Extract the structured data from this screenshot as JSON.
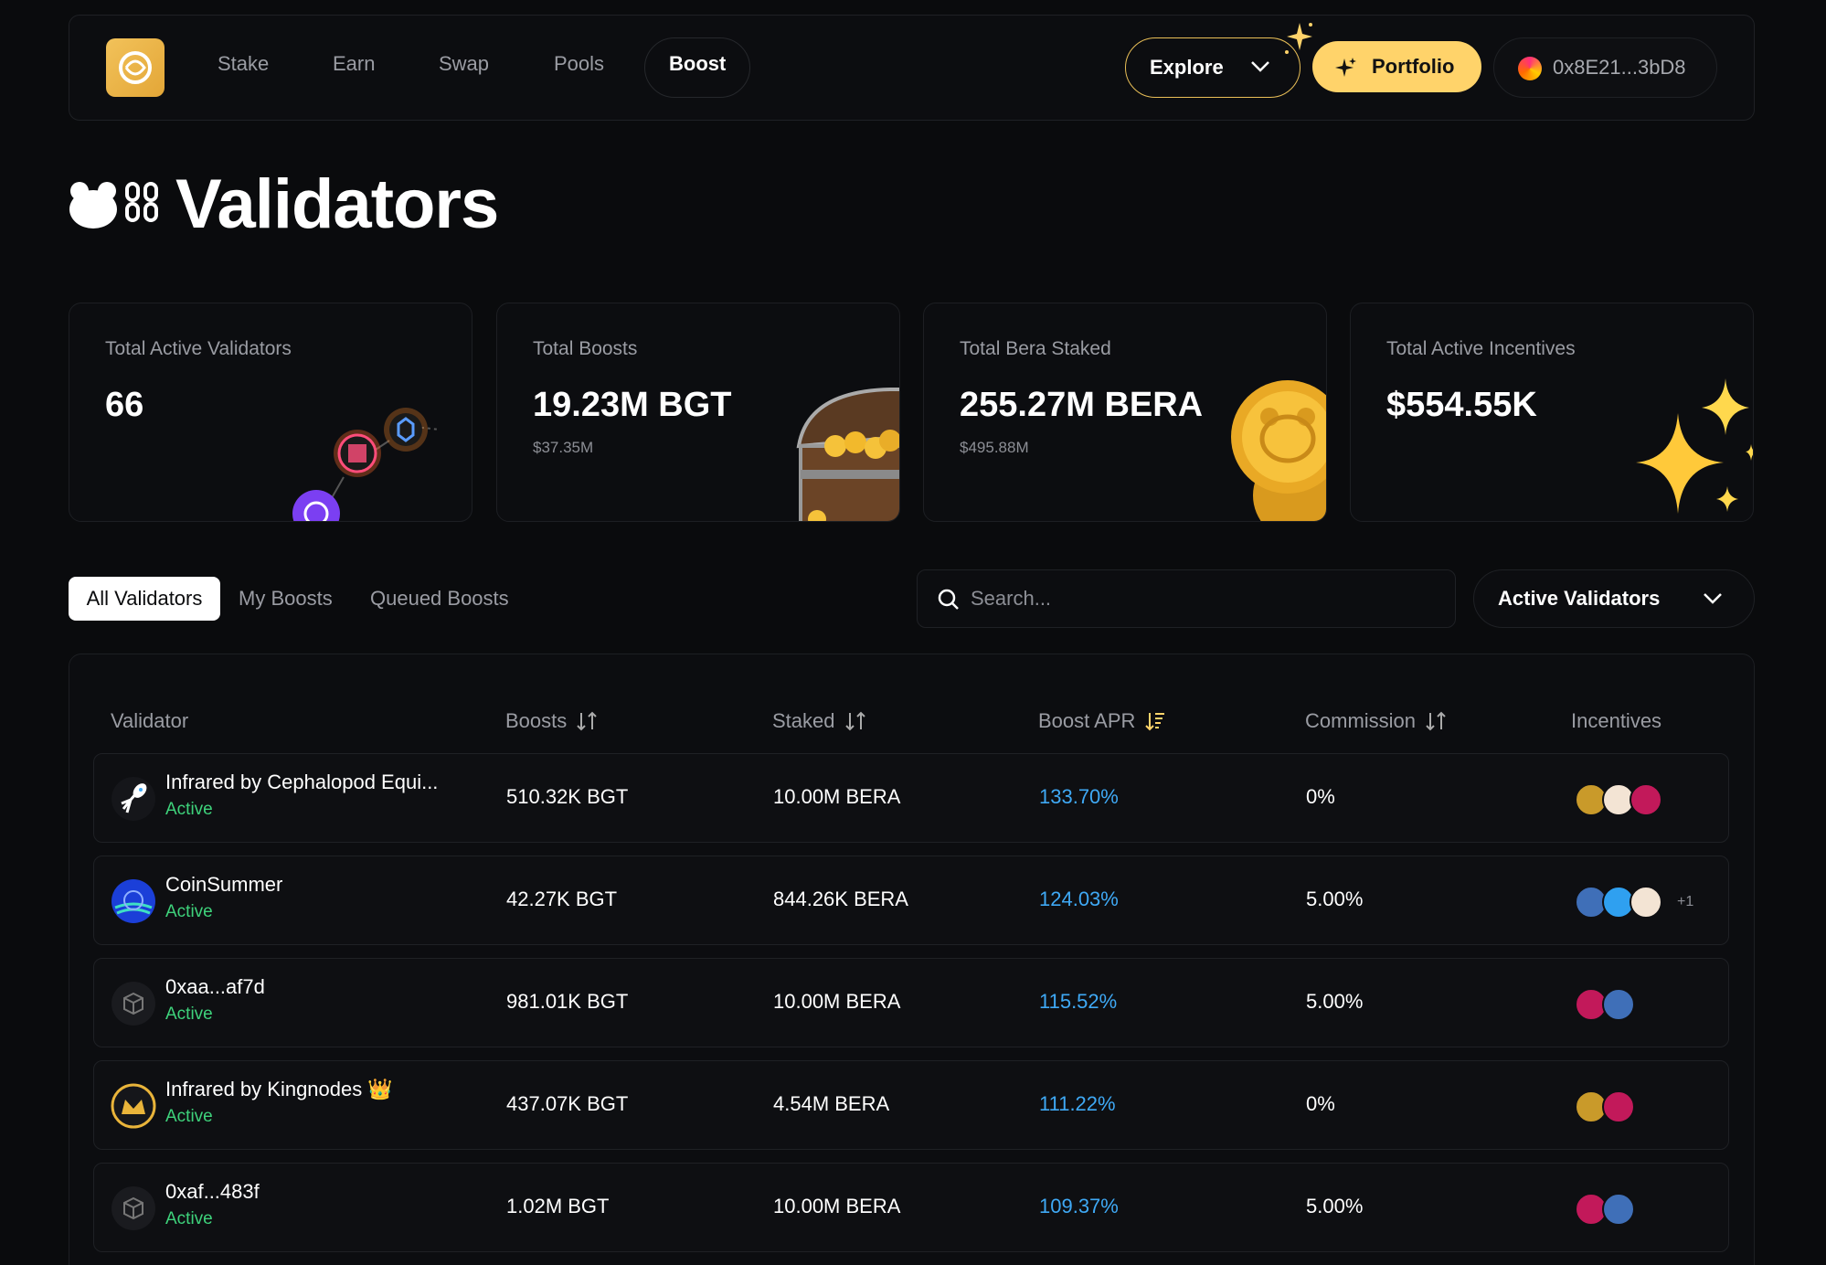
{
  "nav": {
    "links": [
      "Stake",
      "Earn",
      "Swap",
      "Pools",
      "Boost"
    ],
    "active": "Boost",
    "explore_label": "Explore",
    "portfolio_label": "Portfolio",
    "wallet_address": "0x8E21...3bD8"
  },
  "page": {
    "title": "Validators"
  },
  "stats": [
    {
      "label": "Total Active Validators",
      "value": "66",
      "sub": ""
    },
    {
      "label": "Total Boosts",
      "value": "19.23M BGT",
      "sub": "$37.35M"
    },
    {
      "label": "Total Bera Staked",
      "value": "255.27M BERA",
      "sub": "$495.88M"
    },
    {
      "label": "Total Active Incentives",
      "value": "$554.55K",
      "sub": ""
    }
  ],
  "tabs": [
    "All Validators",
    "My Boosts",
    "Queued Boosts"
  ],
  "search": {
    "placeholder": "Search..."
  },
  "filter": {
    "label": "Active Validators"
  },
  "table": {
    "headers": [
      "Validator",
      "Boosts",
      "Staked",
      "Boost APR",
      "Commission",
      "Incentives"
    ],
    "rows": [
      {
        "name": "Infrared by Cephalopod Equi...",
        "status": "Active",
        "boosts": "510.32K BGT",
        "staked": "10.00M BERA",
        "apr": "133.70%",
        "commission": "0%",
        "incentives_more": ""
      },
      {
        "name": "CoinSummer",
        "status": "Active",
        "boosts": "42.27K BGT",
        "staked": "844.26K BERA",
        "apr": "124.03%",
        "commission": "5.00%",
        "incentives_more": "+1"
      },
      {
        "name": "0xaa...af7d",
        "status": "Active",
        "boosts": "981.01K BGT",
        "staked": "10.00M BERA",
        "apr": "115.52%",
        "commission": "5.00%",
        "incentives_more": ""
      },
      {
        "name": "Infrared by Kingnodes 👑",
        "status": "Active",
        "boosts": "437.07K BGT",
        "staked": "4.54M BERA",
        "apr": "111.22%",
        "commission": "0%",
        "incentives_more": ""
      },
      {
        "name": "0xaf...483f",
        "status": "Active",
        "boosts": "1.02M BGT",
        "staked": "10.00M BERA",
        "apr": "109.37%",
        "commission": "5.00%",
        "incentives_more": ""
      }
    ]
  },
  "colors": {
    "accent": "#ffd36a",
    "apr": "#3fa9f5",
    "active": "#3ed27b",
    "bg": "#0a0b0d"
  }
}
